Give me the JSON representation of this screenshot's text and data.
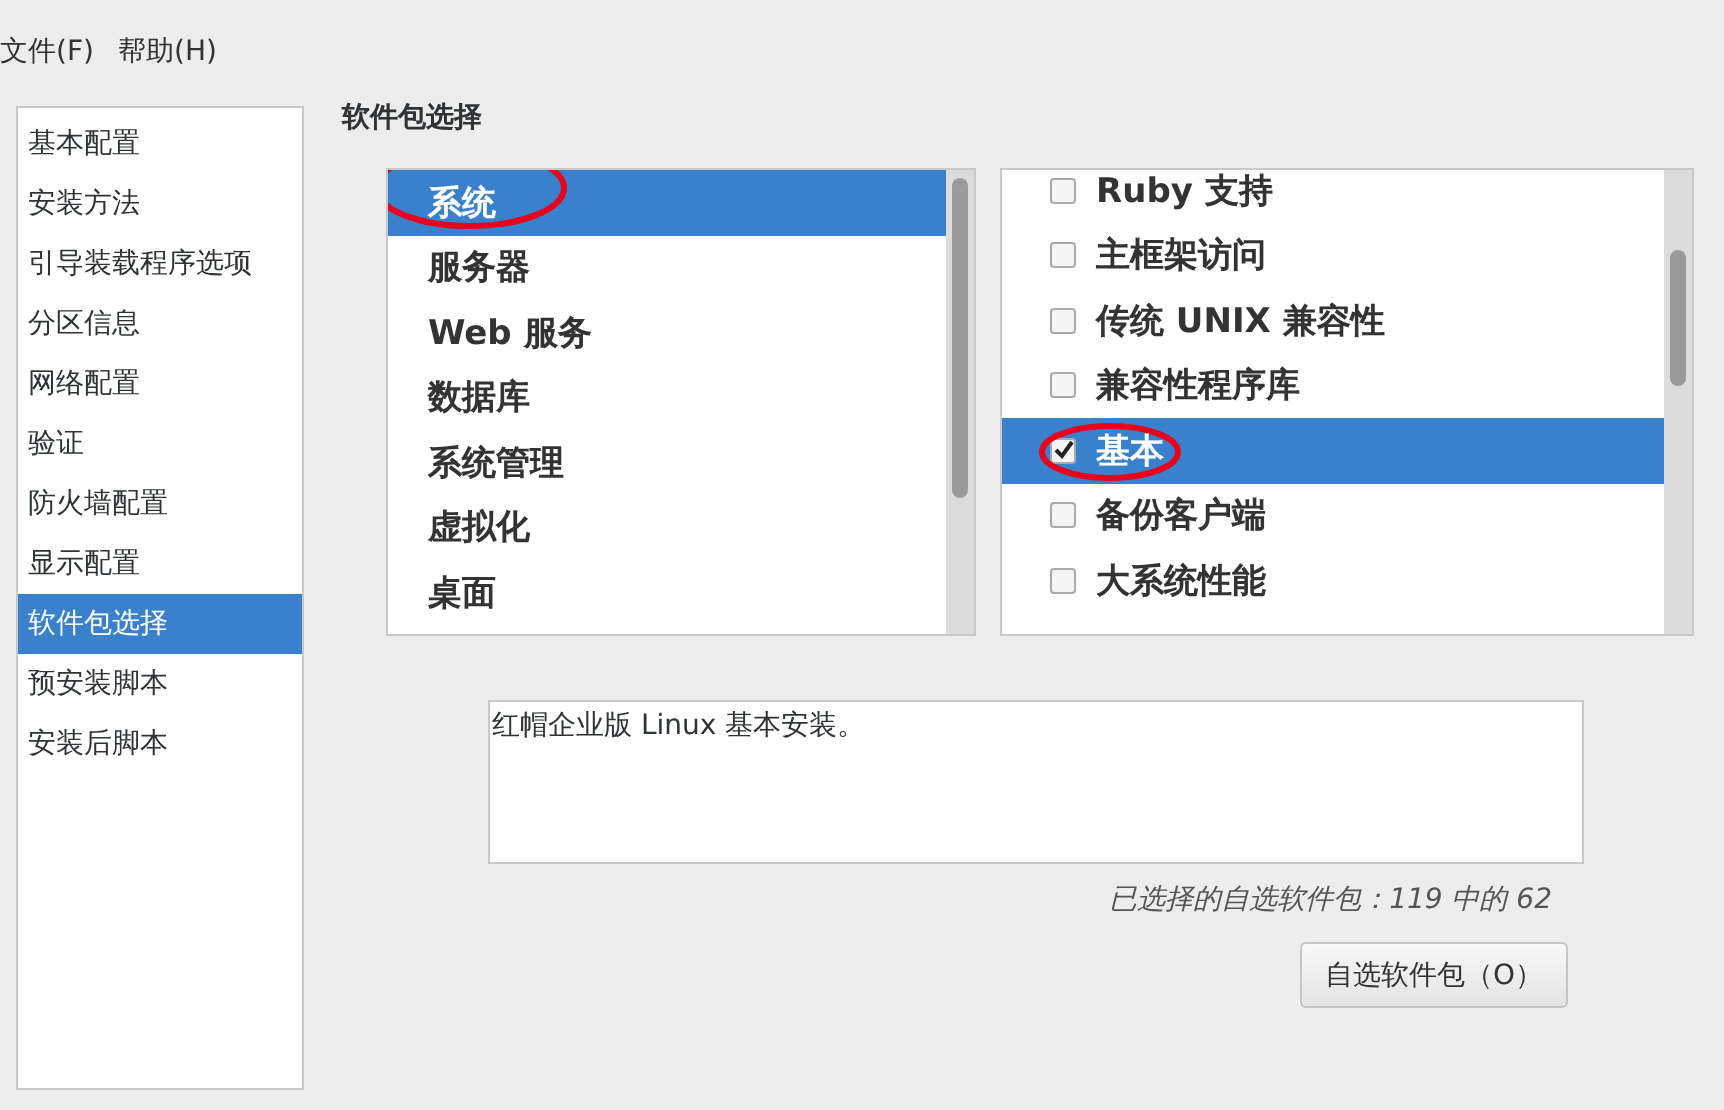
{
  "menu_bar": [
    "文件(F)",
    "帮助(H)"
  ],
  "sidebar": {
    "items": [
      {
        "label": "基本配置",
        "selected": false
      },
      {
        "label": "安装方法",
        "selected": false
      },
      {
        "label": "引导装载程序选项",
        "selected": false
      },
      {
        "label": "分区信息",
        "selected": false
      },
      {
        "label": "网络配置",
        "selected": false
      },
      {
        "label": "验证",
        "selected": false
      },
      {
        "label": "防火墙配置",
        "selected": false
      },
      {
        "label": "显示配置",
        "selected": false
      },
      {
        "label": "软件包选择",
        "selected": true
      },
      {
        "label": "预安装脚本",
        "selected": false
      },
      {
        "label": "安装后脚本",
        "selected": false
      }
    ]
  },
  "heading": "软件包选择",
  "categories": [
    {
      "label": "系统",
      "selected": true,
      "circled": true
    },
    {
      "label": "服务器",
      "selected": false,
      "circled": false
    },
    {
      "label": "Web 服务",
      "selected": false,
      "circled": false
    },
    {
      "label": "数据库",
      "selected": false,
      "circled": false
    },
    {
      "label": "系统管理",
      "selected": false,
      "circled": false
    },
    {
      "label": "虚拟化",
      "selected": false,
      "circled": false
    },
    {
      "label": "桌面",
      "selected": false,
      "circled": false
    }
  ],
  "groups": [
    {
      "label": "Ruby 支持",
      "checked": false,
      "selected": false,
      "circled": false
    },
    {
      "label": "主框架访问",
      "checked": false,
      "selected": false,
      "circled": false
    },
    {
      "label": "传统 UNIX 兼容性",
      "checked": false,
      "selected": false,
      "circled": false
    },
    {
      "label": "兼容性程序库",
      "checked": false,
      "selected": false,
      "circled": false
    },
    {
      "label": "基本",
      "checked": true,
      "selected": true,
      "circled": true
    },
    {
      "label": "备份客户端",
      "checked": false,
      "selected": false,
      "circled": false
    },
    {
      "label": "大系统性能",
      "checked": false,
      "selected": false,
      "circled": false
    }
  ],
  "description": "红帽企业版 Linux 基本安装。",
  "selection_count": "已选择的自选软件包：119 中的 62",
  "optional_button": "自选软件包（O）"
}
